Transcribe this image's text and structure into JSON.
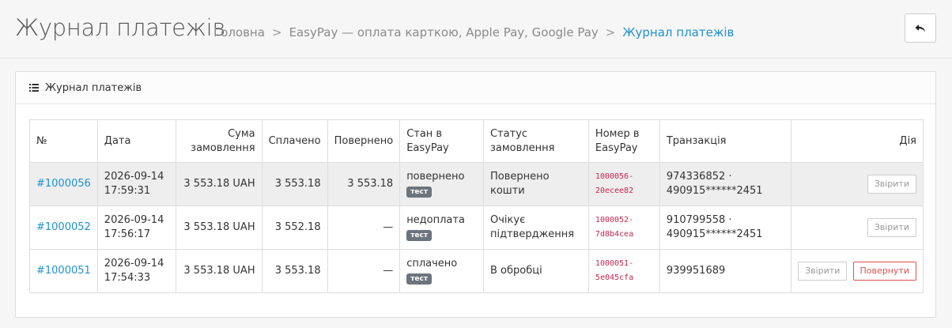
{
  "header": {
    "title": "Журнал платежів",
    "breadcrumb": [
      "Головна",
      "EasyPay — оплата карткою, Apple Pay, Google Pay",
      "Журнал платежів"
    ],
    "separator": ">"
  },
  "panel": {
    "title": "Журнал платежів"
  },
  "table": {
    "columns": {
      "num": "№",
      "date": "Дата",
      "order_sum": "Сума замовлення",
      "paid": "Сплачено",
      "refunded": "Повернено",
      "state": "Стан в EasyPay",
      "order_status": "Статус замовлення",
      "ep_number": "Номер в EasyPay",
      "transaction": "Транзакція",
      "action": "Дія"
    },
    "rows": [
      {
        "order": "#1000056",
        "date": "2026-09-14 17:59:31",
        "sum": "3 553.18 UAH",
        "paid": "3 553.18",
        "refunded": "3 553.18",
        "state": "повернено",
        "badge": "тест",
        "status": "Повернено кошти",
        "ep1": "1000056-",
        "ep2": "20ecee82",
        "tx1": "974336852 ·",
        "tx2": "490915******2451",
        "btn_check": "Звірити"
      },
      {
        "order": "#1000052",
        "date": "2026-09-14 17:56:17",
        "sum": "3 553.18 UAH",
        "paid": "3 552.18",
        "refunded": "—",
        "state": "недоплата",
        "badge": "тест",
        "status": "Очікує підтвердження",
        "ep1": "1000052-",
        "ep2": "7d8b4cea",
        "tx1": "910799558 ·",
        "tx2": "490915******2451",
        "btn_check": "Звірити"
      },
      {
        "order": "#1000051",
        "date": "2026-09-14 17:54:33",
        "sum": "3 553.18 UAH",
        "paid": "3 553.18",
        "refunded": "—",
        "state": "сплачено",
        "badge": "тест",
        "status": "В обробці",
        "ep1": "1000051-",
        "ep2": "5e045cfa",
        "tx1": "939951689",
        "btn_check": "Звірити",
        "btn_refund": "Повернути"
      }
    ]
  },
  "colors": {
    "link": "#1e91cf",
    "code": "#c7254e",
    "danger": "#d9534f",
    "badge": "#6c757d"
  },
  "icons": {
    "back": "reply-icon",
    "list": "list-icon"
  }
}
